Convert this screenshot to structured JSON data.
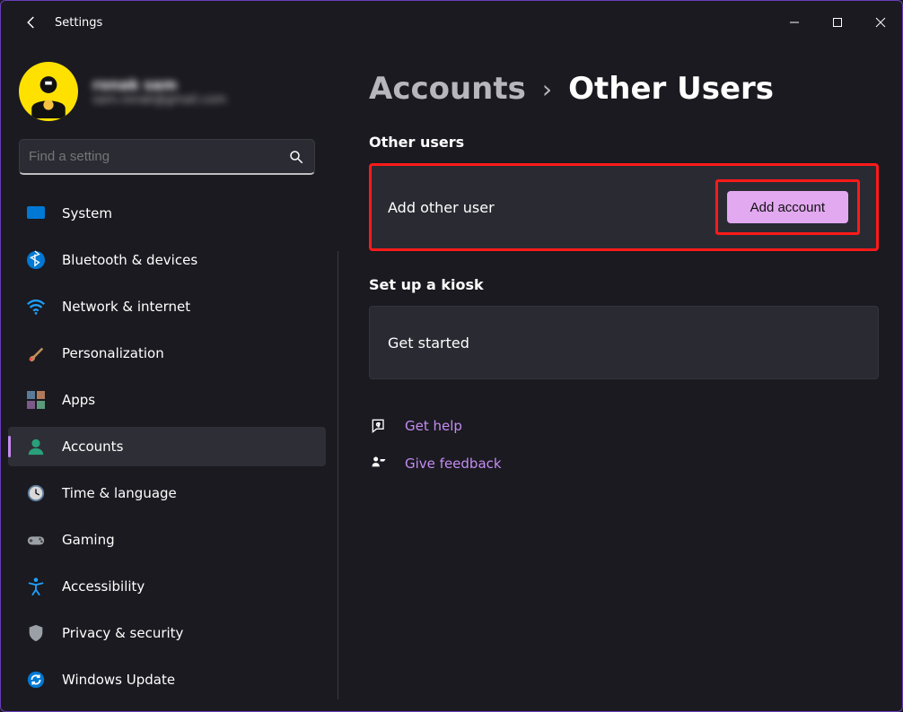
{
  "window": {
    "title": "Settings"
  },
  "user": {
    "name": "ronak sam",
    "email": "sam.ronak@gmail.com"
  },
  "search": {
    "placeholder": "Find a setting"
  },
  "nav": {
    "items": [
      {
        "id": "system",
        "label": "System"
      },
      {
        "id": "bluetooth",
        "label": "Bluetooth & devices"
      },
      {
        "id": "network",
        "label": "Network & internet"
      },
      {
        "id": "personalization",
        "label": "Personalization"
      },
      {
        "id": "apps",
        "label": "Apps"
      },
      {
        "id": "accounts",
        "label": "Accounts",
        "active": true
      },
      {
        "id": "time",
        "label": "Time & language"
      },
      {
        "id": "gaming",
        "label": "Gaming"
      },
      {
        "id": "accessibility",
        "label": "Accessibility"
      },
      {
        "id": "privacy",
        "label": "Privacy & security"
      },
      {
        "id": "update",
        "label": "Windows Update"
      }
    ]
  },
  "breadcrumb": {
    "parent": "Accounts",
    "current": "Other Users"
  },
  "sections": {
    "other_users": {
      "label": "Other users",
      "card_text": "Add other user",
      "button": "Add account"
    },
    "kiosk": {
      "label": "Set up a kiosk",
      "card_text": "Get started"
    }
  },
  "links": {
    "help": "Get help",
    "feedback": "Give feedback"
  },
  "highlight_colors": {
    "emphasis_border": "#ff1a1a",
    "accent": "#c58cf2",
    "button_bg": "#e2a8f0"
  }
}
